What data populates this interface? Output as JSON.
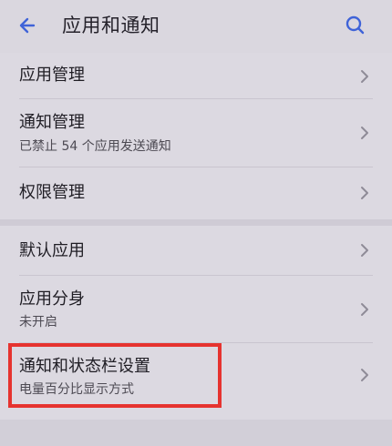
{
  "header": {
    "back_icon": "back-arrow-icon",
    "title": "应用和通知",
    "search_icon": "search-icon",
    "accent_color": "#3f63d8"
  },
  "items": [
    {
      "label": "应用管理",
      "subtext": ""
    },
    {
      "label": "通知管理",
      "subtext": "已禁止 54 个应用发送通知"
    },
    {
      "label": "权限管理",
      "subtext": ""
    },
    {
      "label": "默认应用",
      "subtext": ""
    },
    {
      "label": "应用分身",
      "subtext": "未开启"
    },
    {
      "label": "通知和状态栏设置",
      "subtext": "电量百分比显示方式"
    }
  ],
  "highlight": {
    "target": "通知和状态栏设置",
    "color": "#e6332f"
  }
}
